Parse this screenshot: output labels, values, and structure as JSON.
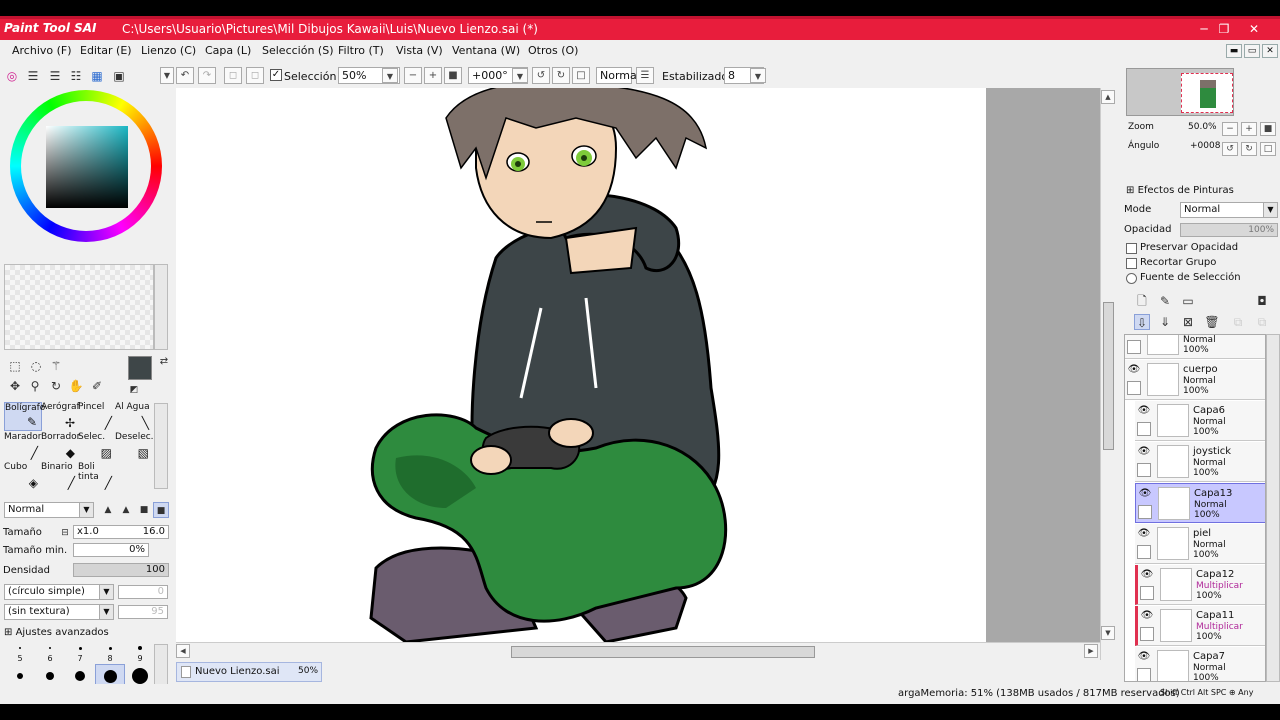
{
  "window": {
    "app_logo": "Paint Tool SAI",
    "title": "C:\\Users\\Usuario\\Pictures\\Mil Dibujos Kawaii\\Luis\\Nuevo Lienzo.sai (*)",
    "minimize": "─",
    "maximize": "❐",
    "close": "✕"
  },
  "menu": [
    "Archivo (F)",
    "Editar (E)",
    "Lienzo (C)",
    "Capa (L)",
    "Selección (S)",
    "Filtro (T)",
    "Vista (V)",
    "Ventana (W)",
    "Otros (O)"
  ],
  "toolbar": {
    "selection_label": "Selección",
    "zoom": "50%",
    "angle": "+000°",
    "mode": "Normal",
    "stabilizer_label": "Estabilizador",
    "stabilizer": "8"
  },
  "left": {
    "tools": [
      {
        "label": "Bolígrafo",
        "icon": "✎"
      },
      {
        "label": "Aerógraf",
        "icon": "✢"
      },
      {
        "label": "Pincel",
        "icon": "╱"
      },
      {
        "label": "Al Agua",
        "icon": "╲"
      },
      {
        "label": "Marador",
        "icon": "╱"
      },
      {
        "label": "Borrador",
        "icon": "◆"
      },
      {
        "label": "Selec.",
        "icon": "▨"
      },
      {
        "label": "Deselec.",
        "icon": "▧"
      },
      {
        "label": "Cubo",
        "icon": "◈"
      },
      {
        "label": "Binario",
        "icon": "╱"
      },
      {
        "label": "Boli tinta",
        "icon": "╱"
      }
    ],
    "blend_mode": "Normal",
    "size_label": "Tamaño",
    "size_mult": "x1.0",
    "size_value": "16.0",
    "min_size_label": "Tamaño min.",
    "min_size_value": "0%",
    "density_label": "Densidad",
    "density_value": "100",
    "shape": "(círculo simple)",
    "shape_val": "0",
    "texture": "(sin textura)",
    "texture_val": "95",
    "advanced": "Ajustes avanzados",
    "brush_sizes_row1": [
      "5",
      "6",
      "7",
      "8",
      "9"
    ],
    "brush_sizes_row2": [
      "10",
      "12",
      "14",
      "16",
      "20"
    ]
  },
  "tab": {
    "name": "Nuevo Lienzo.sai",
    "zoom": "50%"
  },
  "right": {
    "zoom_label": "Zoom",
    "zoom_value": "50.0%",
    "angle_label": "Ángulo",
    "angle_value": "+0008",
    "effects": "Efectos de Pinturas",
    "mode_label": "Mode",
    "mode_value": "Normal",
    "opacity_label": "Opacidad",
    "opacity_value": "100%",
    "preserve_opacity": "Preservar Opacidad",
    "clip_group": "Recortar Grupo",
    "selection_source": "Fuente de Selección",
    "layers": [
      {
        "name": "",
        "mode": "Normal",
        "opacity": "100%"
      },
      {
        "name": "cuerpo",
        "mode": "Normal",
        "opacity": "100%"
      },
      {
        "name": "Capa6",
        "mode": "Normal",
        "opacity": "100%"
      },
      {
        "name": "joystick",
        "mode": "Normal",
        "opacity": "100%"
      },
      {
        "name": "Capa13",
        "mode": "Normal",
        "opacity": "100%"
      },
      {
        "name": "piel",
        "mode": "Normal",
        "opacity": "100%"
      },
      {
        "name": "Capa12",
        "mode": "Multiplicar",
        "opacity": "100%"
      },
      {
        "name": "Capa11",
        "mode": "Multiplicar",
        "opacity": "100%"
      },
      {
        "name": "Capa7",
        "mode": "Normal",
        "opacity": "100%"
      }
    ]
  },
  "status": {
    "memory": "argaMemoria: 51% (138MB usados / 817MB reservados)",
    "keys": "Shift Ctrl Alt SPC ⊕ Any"
  },
  "colors": {
    "title_bar": "#e81d3c",
    "selected_layer": "#c8c8ff",
    "accent": "#8aa0d8"
  }
}
